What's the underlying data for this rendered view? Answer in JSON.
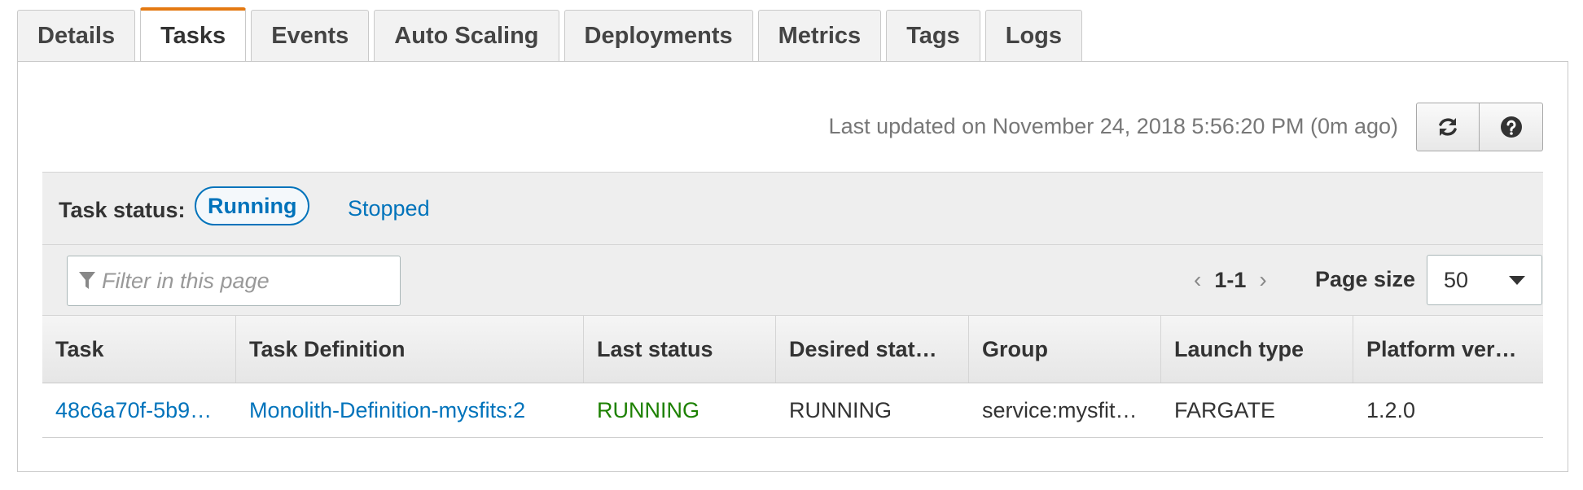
{
  "tabs": [
    {
      "label": "Details"
    },
    {
      "label": "Tasks",
      "active": true
    },
    {
      "label": "Events"
    },
    {
      "label": "Auto Scaling"
    },
    {
      "label": "Deployments"
    },
    {
      "label": "Metrics"
    },
    {
      "label": "Tags"
    },
    {
      "label": "Logs"
    }
  ],
  "toolbar": {
    "last_updated": "Last updated on November 24, 2018 5:56:20 PM (0m ago)",
    "refresh_icon": "refresh-icon",
    "help_icon": "help-icon"
  },
  "status_filter": {
    "label": "Task status:",
    "running": "Running",
    "stopped": "Stopped"
  },
  "filter": {
    "placeholder": "Filter in this page",
    "icon": "filter-icon"
  },
  "pagination": {
    "prev": "‹",
    "range": "1-1",
    "next": "›",
    "page_size_label": "Page size",
    "page_size": "50"
  },
  "table": {
    "columns": [
      "Task",
      "Task Definition",
      "Last status",
      "Desired stat…",
      "Group",
      "Launch type",
      "Platform ver…"
    ],
    "rows": [
      [
        "48c6a70f-5b9…",
        "Monolith-Definition-mysfits:2",
        "RUNNING",
        "RUNNING",
        "service:mysfit…",
        "FARGATE",
        "1.2.0"
      ]
    ]
  },
  "colors": {
    "accent": "#e47911",
    "link": "#0073bb",
    "running": "#1d8102"
  }
}
